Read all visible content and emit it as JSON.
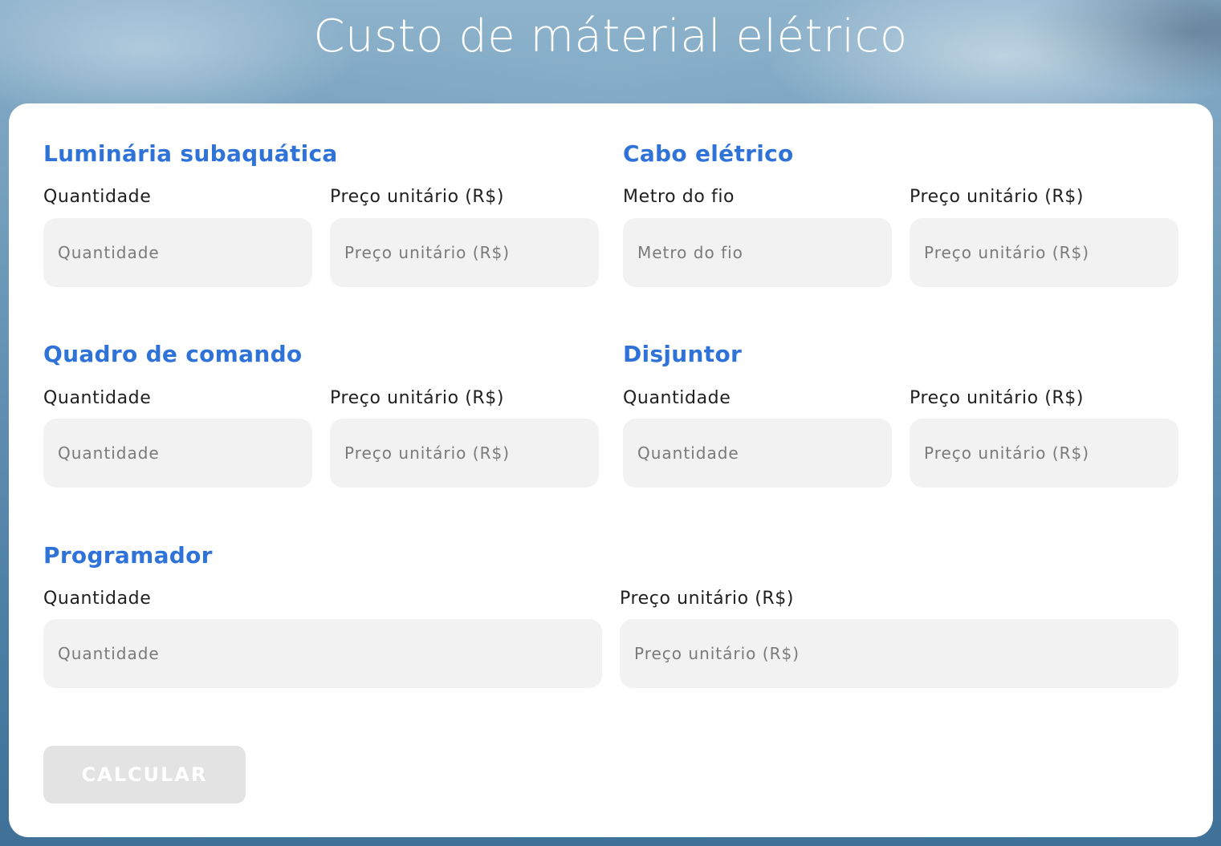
{
  "page": {
    "title": "Custo de máterial elétrico"
  },
  "sections": {
    "luminaria": {
      "title": "Luminária subaquática",
      "qty_label": "Quantidade",
      "qty_placeholder": "Quantidade",
      "price_label": "Preço unitário (R$)",
      "price_placeholder": "Preço unitário (R$)"
    },
    "cabo": {
      "title": "Cabo elétrico",
      "qty_label": "Metro do fio",
      "qty_placeholder": "Metro do fio",
      "price_label": "Preço unitário (R$)",
      "price_placeholder": "Preço unitário (R$)"
    },
    "quadro": {
      "title": "Quadro de comando",
      "qty_label": "Quantidade",
      "qty_placeholder": "Quantidade",
      "price_label": "Preço unitário (R$)",
      "price_placeholder": "Preço unitário (R$)"
    },
    "disjuntor": {
      "title": "Disjuntor",
      "qty_label": "Quantidade",
      "qty_placeholder": "Quantidade",
      "price_label": "Preço unitário (R$)",
      "price_placeholder": "Preço unitário (R$)"
    },
    "programador": {
      "title": "Programador",
      "qty_label": "Quantidade",
      "qty_placeholder": "Quantidade",
      "price_label": "Preço unitário (R$)",
      "price_placeholder": "Preço unitário (R$)"
    }
  },
  "actions": {
    "calculate_label": "CALCULAR"
  },
  "colors": {
    "section_title": "#2f73d8",
    "input_background": "#f2f2f2",
    "button_disabled": "#e3e3e3"
  }
}
